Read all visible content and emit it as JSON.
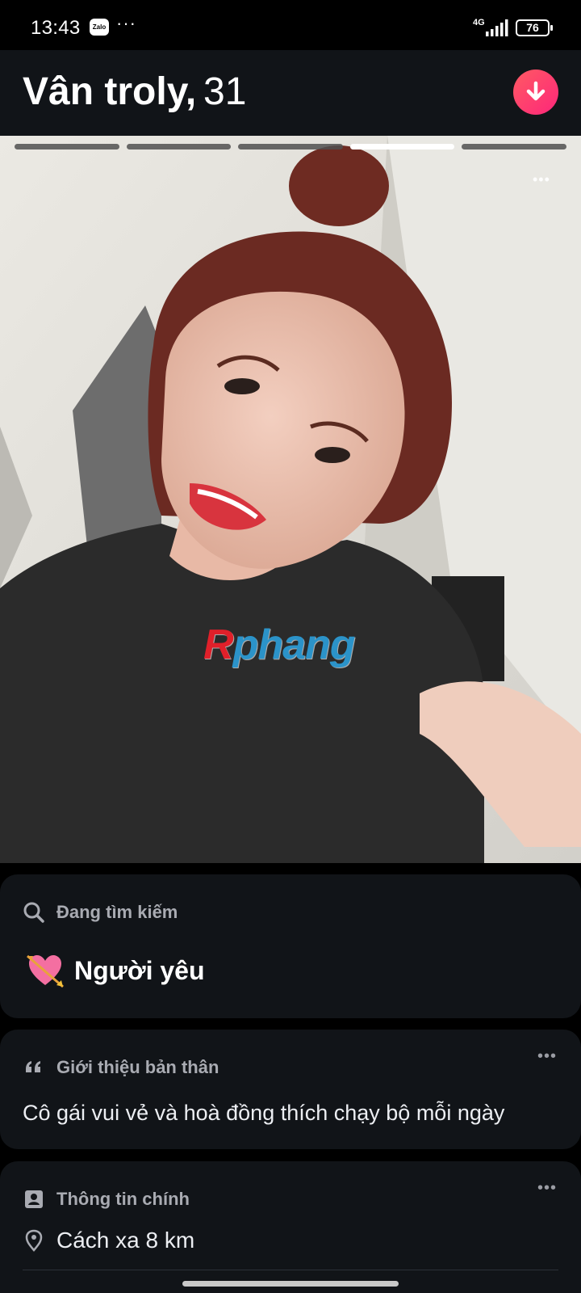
{
  "status_bar": {
    "time": "13:43",
    "zalo_label": "Zalo",
    "more": "···",
    "network": "4G",
    "battery": "76"
  },
  "header": {
    "name": "Vân troly,",
    "age": "31",
    "collapse_icon": "arrow-down-icon",
    "accent_color": "#fd4a6a"
  },
  "photo": {
    "progress": {
      "total": 5,
      "active_index": 3
    },
    "more": "•••",
    "watermark_first": "R",
    "watermark_rest": "phang"
  },
  "looking_for": {
    "title": "Đang tìm kiếm",
    "icon": "search-icon",
    "emoji": "heart-with-arrow",
    "value": "Người yêu"
  },
  "about": {
    "title": "Giới thiệu bản thân",
    "icon": "quote-icon",
    "more": "•••",
    "text": "Cô gái vui vẻ và hoà đồng thích chạy bộ mỗi ngày"
  },
  "basic_info": {
    "title": "Thông tin chính",
    "icon": "profile-card-icon",
    "more": "•••",
    "distance_icon": "location-pin-icon",
    "distance": "Cách xa 8 km"
  }
}
